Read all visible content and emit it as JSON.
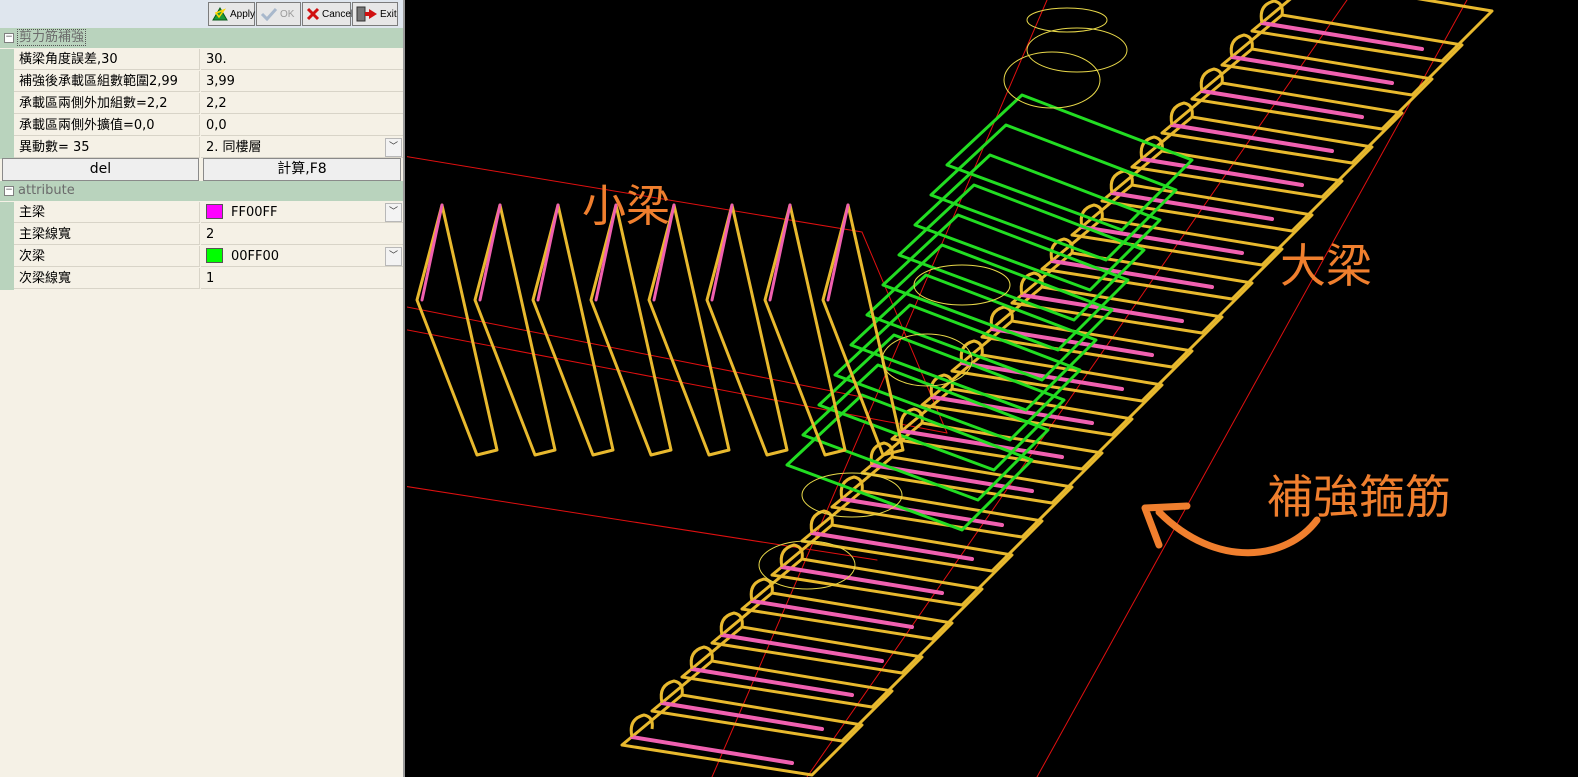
{
  "toolbar": {
    "apply_label": "Apply",
    "ok_label": "OK",
    "cancel_label": "Cancel",
    "exit_label": "Exit"
  },
  "group1": {
    "title": "剪力筋補強",
    "rows": [
      {
        "name": "橫梁角度誤差,30",
        "value": "30."
      },
      {
        "name": "補強後承載區組數範圍2,99",
        "value": "3,99"
      },
      {
        "name": "承載區兩側外加組數=2,2",
        "value": "2,2"
      },
      {
        "name": "承載區兩側外擴值=0,0",
        "value": "0,0"
      },
      {
        "name": "異動數= 35",
        "value": "2. 同樓層"
      }
    ],
    "del_label": "del",
    "calc_label": "計算,F8"
  },
  "group2": {
    "title": "attribute",
    "rows": [
      {
        "name": "主梁",
        "value": "FF00FF",
        "color": "#FF00FF"
      },
      {
        "name": "主梁線寬",
        "value": "2"
      },
      {
        "name": "次梁",
        "value": "00FF00",
        "color": "#00FF00"
      },
      {
        "name": "次梁線寬",
        "value": "1"
      }
    ]
  },
  "annotations": {
    "small_beam": "小梁",
    "main_beam": "大梁",
    "reinforce": "補強箍筋"
  },
  "colors": {
    "stirrup": "#E8B92E",
    "hook": "#F060B0",
    "reinforce": "#22DD22",
    "guide": "#E01010",
    "annotation": "#F07F2E"
  }
}
